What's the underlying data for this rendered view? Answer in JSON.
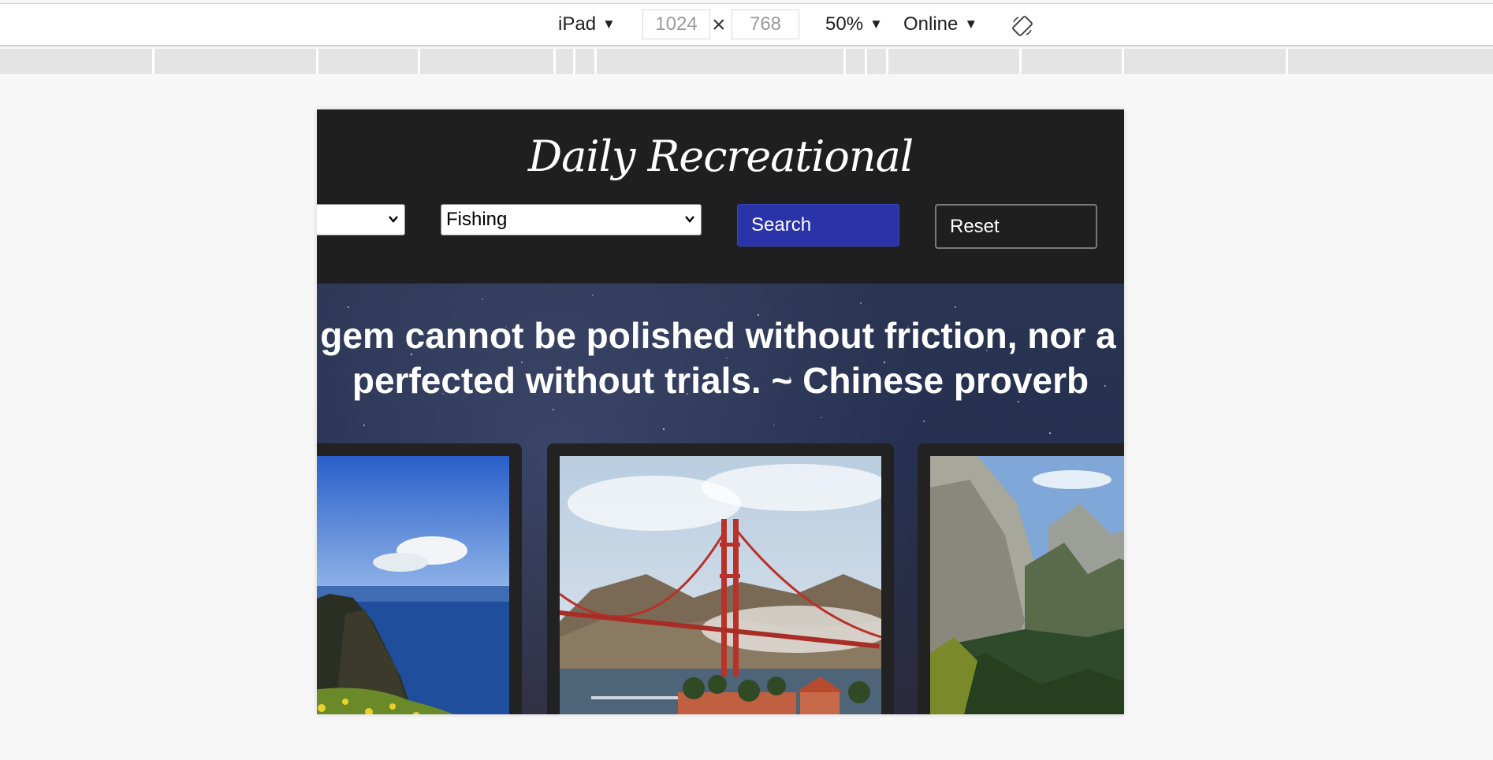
{
  "devtools": {
    "device": "iPad",
    "width": "1024",
    "height": "768",
    "times": "×",
    "zoom": "50%",
    "network": "Online",
    "caret": "▼"
  },
  "site": {
    "title": "Daily Recreational",
    "filters": {
      "second_select_value": "Fishing",
      "first_select_value": ""
    },
    "search_label": "Search",
    "reset_label": "Reset"
  },
  "hero": {
    "quote_line1": "A gem cannot be polished without friction, nor a man",
    "quote_line2": "perfected without trials. ~ Chinese proverb"
  },
  "cards": [
    {
      "image": "coastal-cliffs-photo"
    },
    {
      "image": "golden-gate-bridge-photo"
    },
    {
      "image": "yosemite-valley-photo"
    }
  ]
}
